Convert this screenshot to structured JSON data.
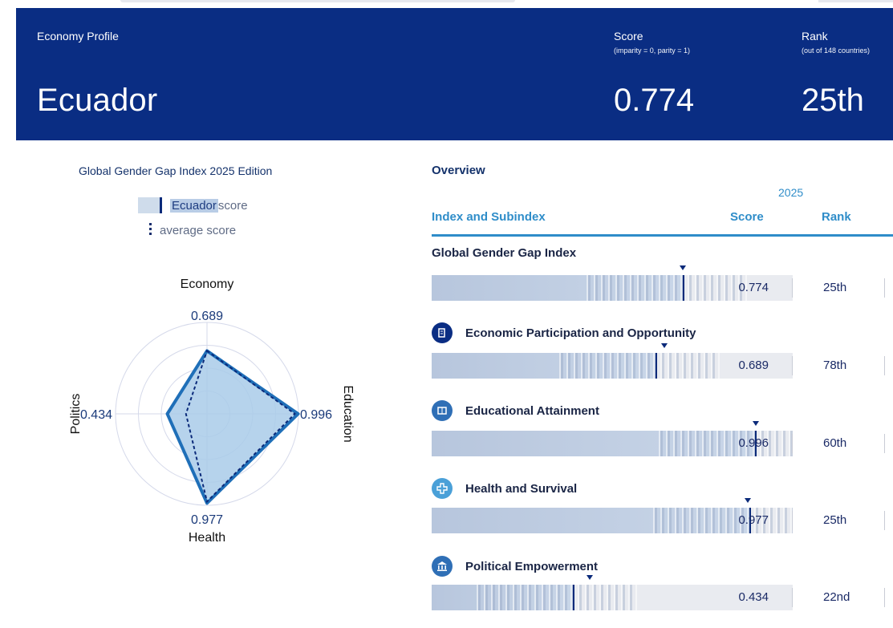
{
  "header": {
    "profile_label": "Economy Profile",
    "country": "Ecuador",
    "score_label": "Score",
    "score_sub": "(imparity = 0, parity = 1)",
    "score_value": "0.774",
    "rank_label": "Rank",
    "rank_sub": "(out of 148 countries)",
    "rank_value": "25th"
  },
  "left": {
    "title": "Global Gender Gap Index 2025 Edition",
    "legend_country": "Ecuador",
    "legend_score_suffix": " score",
    "legend_average": "average score"
  },
  "radar": {
    "axes": [
      {
        "name": "Economy",
        "value": 0.689,
        "label": "0.689",
        "avg": 0.69
      },
      {
        "name": "Education",
        "value": 0.996,
        "label": "0.996",
        "avg": 0.96
      },
      {
        "name": "Health",
        "value": 0.977,
        "label": "0.977",
        "avg": 0.96
      },
      {
        "name": "Politics",
        "value": 0.434,
        "label": "0.434",
        "avg": 0.23
      }
    ],
    "max": 1,
    "colors": {
      "fill": "#a9cbe9",
      "stroke": "#1f6fb8",
      "avg": "#0b2a7a",
      "grid": "#d5d9ea"
    }
  },
  "overview": {
    "title": "Overview",
    "year": "2025",
    "col_index": "Index and Subindex",
    "col_score": "Score",
    "col_rank": "Rank",
    "rows": [
      {
        "title": "Global Gender Gap Index",
        "icon": "",
        "score": 0.774,
        "score_label": "0.774",
        "avg": 0.772,
        "rank": "25th",
        "icon_style": ""
      },
      {
        "title": "Economic Participation and Opportunity",
        "icon": "economy-icon",
        "score": 0.689,
        "score_label": "0.689",
        "avg": 0.715,
        "rank": "78th",
        "icon_style": "dark"
      },
      {
        "title": "Educational Attainment",
        "icon": "book-icon",
        "score": 0.996,
        "score_label": "0.996",
        "avg": 0.998,
        "rank": "60th",
        "icon_style": "mid"
      },
      {
        "title": "Health and Survival",
        "icon": "health-cross-icon",
        "score": 0.977,
        "score_label": "0.977",
        "avg": 0.973,
        "rank": "25th",
        "icon_style": "light"
      },
      {
        "title": "Political Empowerment",
        "icon": "government-building-icon",
        "score": 0.434,
        "score_label": "0.434",
        "avg": 0.486,
        "rank": "22nd",
        "icon_style": "mid"
      }
    ]
  },
  "colors": {
    "header_bg": "#0a2d83",
    "accent": "#2f8dc9",
    "bar_bg": "#e9ebf0",
    "bar_fill": "#c7d3e6",
    "marker": "#0b2a7a"
  }
}
